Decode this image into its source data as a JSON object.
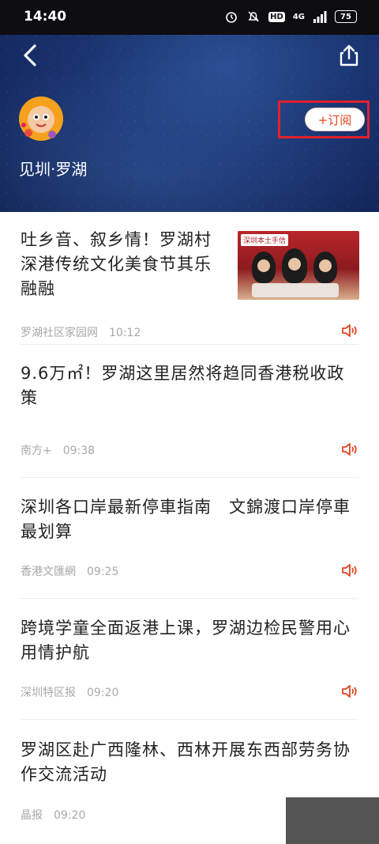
{
  "status_bar": {
    "time": "14:40",
    "hd": "HD",
    "signal": "4G",
    "battery": "75"
  },
  "channel": {
    "name": "见圳·罗湖",
    "subscribe_label": "+订阅"
  },
  "articles": [
    {
      "title": "吐乡音、叙乡情！罗湖村深港传统文化美食节其乐融融",
      "source": "罗湖社区家园网",
      "time": "10:12",
      "thumb_label": "深圳本土手信"
    },
    {
      "title": "9.6万㎡！罗湖这里居然将趋同香港税收政策",
      "source": "南方+",
      "time": "09:38"
    },
    {
      "title": "深圳各口岸最新停車指南　文錦渡口岸停車最划算",
      "source": "香港文匯網",
      "time": "09:25"
    },
    {
      "title": "跨境学童全面返港上课，罗湖边检民警用心用情护航",
      "source": "深圳特区报",
      "time": "09:20"
    },
    {
      "title": "罗湖区赴广西隆林、西林开展东西部劳务协作交流活动",
      "source": "晶报",
      "time": "09:20"
    }
  ],
  "colors": {
    "accent": "#e2451e",
    "header_bg": "#1a3370",
    "highlight": "#e0202c"
  }
}
